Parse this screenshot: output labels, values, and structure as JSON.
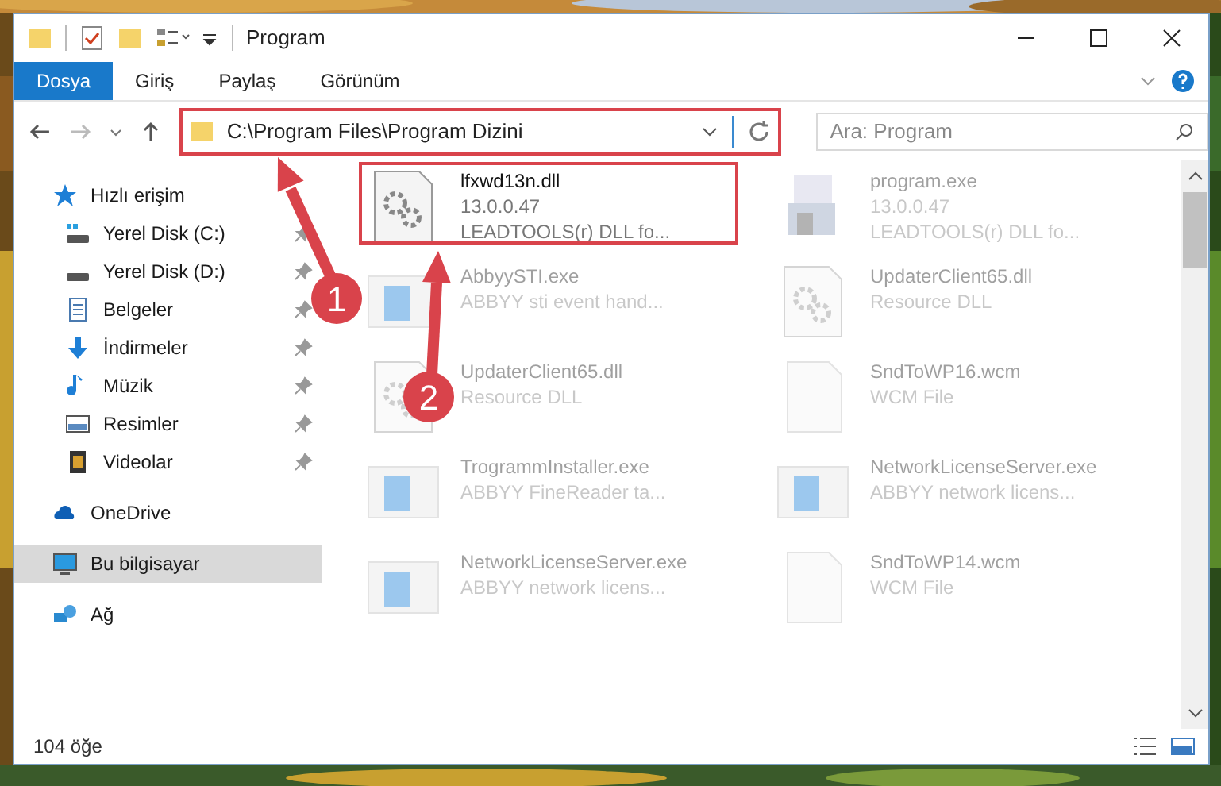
{
  "window": {
    "title": "Program"
  },
  "ribbon_tabs": [
    {
      "label": "Dosya",
      "selected": true
    },
    {
      "label": "Giriş",
      "selected": false
    },
    {
      "label": "Paylaş",
      "selected": false
    },
    {
      "label": "Görünüm",
      "selected": false
    }
  ],
  "address_bar": {
    "path": "C:\\Program Files\\Program Dizini",
    "highlighted": true
  },
  "search": {
    "placeholder": "Ara: Program"
  },
  "sidebar": {
    "items": [
      {
        "label": "Hızlı erişim",
        "kind": "star",
        "selected": false,
        "children": [
          {
            "label": "Yerel Disk (C:)",
            "kind": "drive-c",
            "pinned": true,
            "selected": false
          },
          {
            "label": "Yerel Disk (D:)",
            "kind": "drive",
            "pinned": true,
            "selected": false
          },
          {
            "label": "Belgeler",
            "kind": "doc",
            "pinned": true,
            "selected": false
          },
          {
            "label": "İndirmeler",
            "kind": "download",
            "pinned": true,
            "selected": false
          },
          {
            "label": "Müzik",
            "kind": "music",
            "pinned": true,
            "selected": false
          },
          {
            "label": "Resimler",
            "kind": "pictures",
            "pinned": true,
            "selected": false
          },
          {
            "label": "Videolar",
            "kind": "video",
            "pinned": true,
            "selected": false
          }
        ]
      },
      {
        "label": "OneDrive",
        "kind": "cloud",
        "selected": false
      },
      {
        "label": "Bu bilgisayar",
        "kind": "pc",
        "selected": true
      },
      {
        "label": "Ağ",
        "kind": "network",
        "selected": false
      }
    ]
  },
  "files": [
    {
      "name": "lfxwd13n.dll",
      "lines": [
        "13.0.0.47",
        "LEADTOOLS(r) DLL fo..."
      ],
      "kind": "dll",
      "faded": false,
      "highlighted": true
    },
    {
      "name": "program.exe",
      "lines": [
        "13.0.0.47",
        "LEADTOOLS(r) DLL fo..."
      ],
      "kind": "exe-setup",
      "faded": true,
      "highlighted": false
    },
    {
      "name": "AbbyySTI.exe",
      "lines": [
        "ABBYY sti event hand..."
      ],
      "kind": "app",
      "faded": true,
      "highlighted": false
    },
    {
      "name": "UpdaterClient65.dll",
      "lines": [
        "Resource DLL"
      ],
      "kind": "dll",
      "faded": true,
      "highlighted": false
    },
    {
      "name": "UpdaterClient65.dll",
      "lines": [
        "Resource DLL"
      ],
      "kind": "dll",
      "faded": true,
      "highlighted": false
    },
    {
      "name": "SndToWP16.wcm",
      "lines": [
        "WCM File"
      ],
      "kind": "blank",
      "faded": true,
      "highlighted": false
    },
    {
      "name": "TrogrammInstaller.exe",
      "lines": [
        "ABBYY FineReader ta..."
      ],
      "kind": "app",
      "faded": true,
      "highlighted": false
    },
    {
      "name": "NetworkLicenseServer.exe",
      "lines": [
        "ABBYY network licens..."
      ],
      "kind": "app",
      "faded": true,
      "highlighted": false
    },
    {
      "name": "NetworkLicenseServer.exe",
      "lines": [
        "ABBYY network licens..."
      ],
      "kind": "app",
      "faded": true,
      "highlighted": false
    },
    {
      "name": "SndToWP14.wcm",
      "lines": [
        "WCM File"
      ],
      "kind": "blank",
      "faded": true,
      "highlighted": false
    }
  ],
  "status_bar": {
    "count": "104 öğe"
  },
  "annotations": [
    {
      "label": "1"
    },
    {
      "label": "2"
    }
  ]
}
